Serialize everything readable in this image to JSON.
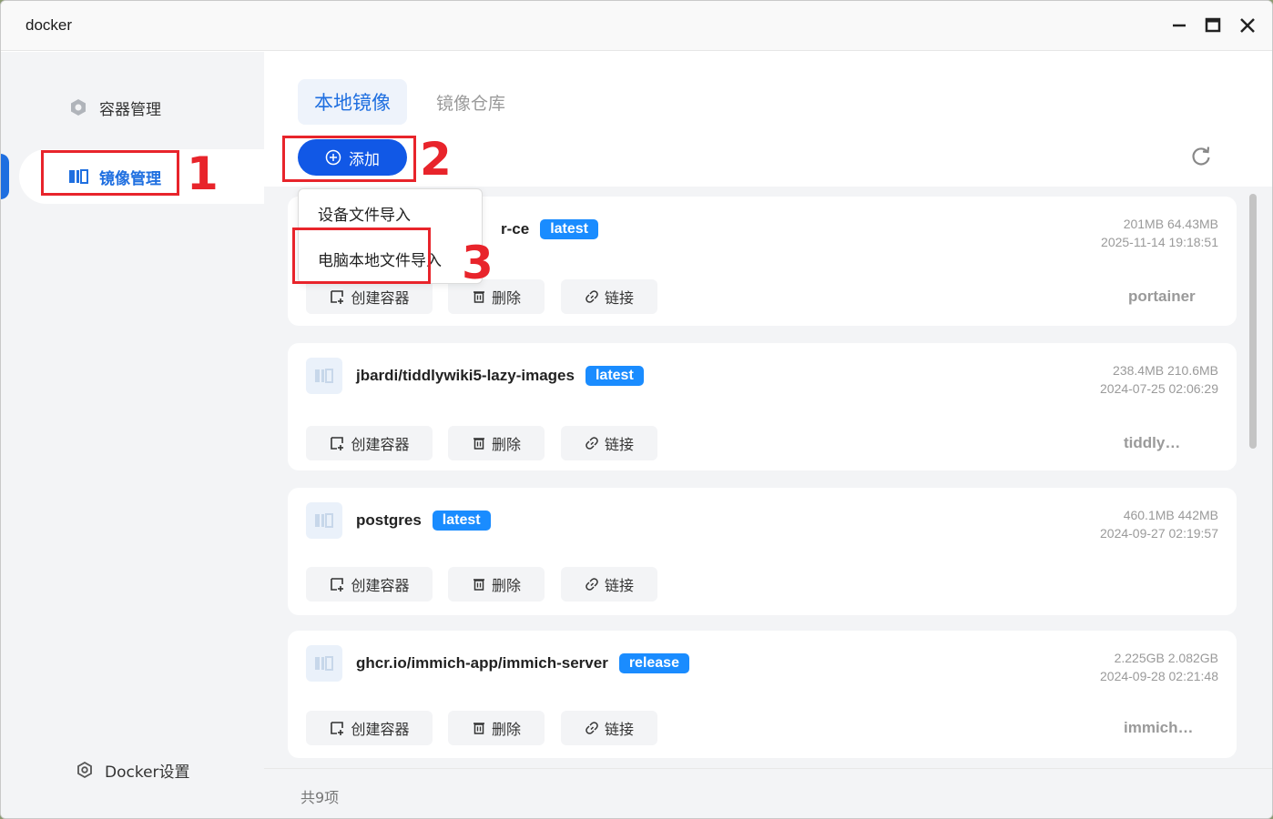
{
  "window": {
    "title": "docker"
  },
  "sidebar": {
    "items": [
      {
        "label": "容器管理",
        "icon": "hexagon-gear-icon"
      },
      {
        "label": "镜像管理",
        "icon": "image-layers-icon",
        "active": true
      }
    ],
    "settings_label": "Docker设置"
  },
  "tabs": [
    {
      "label": "本地镜像",
      "active": true
    },
    {
      "label": "镜像仓库",
      "active": false
    }
  ],
  "toolbar": {
    "add_label": "添加"
  },
  "dropdown": {
    "items": [
      "设备文件导入",
      "电脑本地文件导入"
    ]
  },
  "images": [
    {
      "name": "portainer/portainer-ce",
      "name_visible": "r-ce",
      "tag": "latest",
      "size": "201MB 64.43MB",
      "date": "2025-11-14 19:18:51",
      "container": "portainer"
    },
    {
      "name": "jbardi/tiddlywiki5-lazy-images",
      "tag": "latest",
      "size": "238.4MB 210.6MB",
      "date": "2024-07-25 02:06:29",
      "container": "tiddly…"
    },
    {
      "name": "postgres",
      "tag": "latest",
      "size": "460.1MB 442MB",
      "date": "2024-09-27 02:19:57",
      "container": ""
    },
    {
      "name": "ghcr.io/immich-app/immich-server",
      "tag": "release",
      "size": "2.225GB 2.082GB",
      "date": "2024-09-28 02:21:48",
      "container": "immich…"
    }
  ],
  "actions": {
    "create": "创建容器",
    "delete": "删除",
    "link": "链接"
  },
  "footer": {
    "count": "共9项"
  },
  "annotations": [
    "1",
    "2",
    "3"
  ],
  "colors": {
    "accent": "#1f6fe0",
    "primary_button": "#1158e6",
    "tag": "#1a8cff",
    "annotation": "#e8242b"
  }
}
